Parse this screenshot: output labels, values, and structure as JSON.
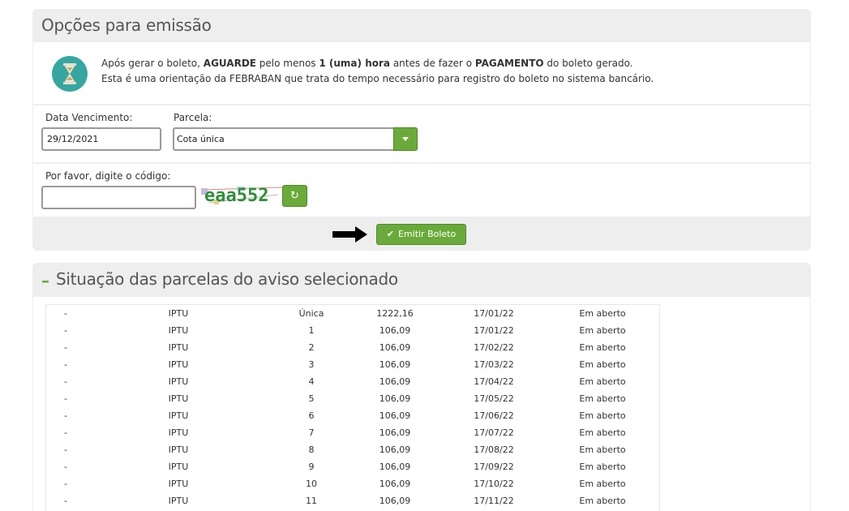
{
  "options_panel": {
    "title": "Opções para emissão",
    "notice": {
      "line1_prefix": "Após gerar o boleto, ",
      "line1_bold1": "AGUARDE",
      "line1_mid": " pelo menos ",
      "line1_bold2": "1 (uma) hora",
      "line1_mid2": " antes de fazer o ",
      "line1_bold3": "PAGAMENTO",
      "line1_suffix": " do boleto gerado.",
      "line2": "Esta é uma orientação da FEBRABAN que trata do tempo necessário para registro do boleto no sistema bancário."
    },
    "due_date": {
      "label": "Data Vencimento:",
      "value": "29/12/2021"
    },
    "installment": {
      "label": "Parcela:",
      "selected": "Cota única"
    },
    "captcha": {
      "label": "Por favor, digite o código:",
      "value": "",
      "image_text": "eaa552"
    },
    "emit_button": {
      "label": "Emitir Boleto"
    }
  },
  "status_panel": {
    "title": "Situação das parcelas do aviso selecionado",
    "rows": [
      [
        "-",
        "IPTU",
        "Única",
        "1222,16",
        "17/01/22",
        "Em aberto"
      ],
      [
        "-",
        "IPTU",
        "1",
        "106,09",
        "17/01/22",
        "Em aberto"
      ],
      [
        "-",
        "IPTU",
        "2",
        "106,09",
        "17/02/22",
        "Em aberto"
      ],
      [
        "-",
        "IPTU",
        "3",
        "106,09",
        "17/03/22",
        "Em aberto"
      ],
      [
        "-",
        "IPTU",
        "4",
        "106,09",
        "17/04/22",
        "Em aberto"
      ],
      [
        "-",
        "IPTU",
        "5",
        "106,09",
        "17/05/22",
        "Em aberto"
      ],
      [
        "-",
        "IPTU",
        "6",
        "106,09",
        "17/06/22",
        "Em aberto"
      ],
      [
        "-",
        "IPTU",
        "7",
        "106,09",
        "17/07/22",
        "Em aberto"
      ],
      [
        "-",
        "IPTU",
        "8",
        "106,09",
        "17/08/22",
        "Em aberto"
      ],
      [
        "-",
        "IPTU",
        "9",
        "106,09",
        "17/09/22",
        "Em aberto"
      ],
      [
        "-",
        "IPTU",
        "10",
        "106,09",
        "17/10/22",
        "Em aberto"
      ],
      [
        "-",
        "IPTU",
        "11",
        "106,09",
        "17/11/22",
        "Em aberto"
      ]
    ]
  },
  "colors": {
    "accent_green": "#6aaa3a",
    "hourglass_teal": "#35a7a0",
    "panel_gray": "#eeeeee"
  },
  "icons": [
    "hourglass-icon",
    "chevron-down-icon",
    "refresh-icon",
    "check-icon",
    "arrow-right-icon",
    "collapse-minus-icon"
  ]
}
